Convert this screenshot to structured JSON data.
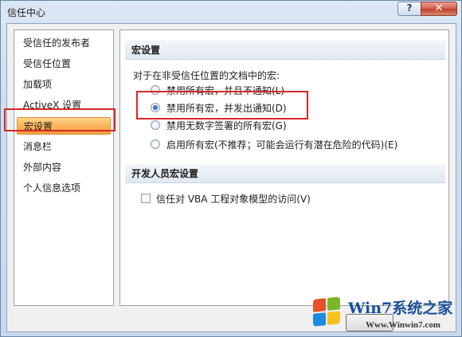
{
  "window": {
    "title": "信任中心",
    "help_label": "?",
    "close_label": "✕"
  },
  "nav": {
    "items": [
      {
        "label": "受信任的发布者",
        "active": false
      },
      {
        "label": "受信任位置",
        "active": false
      },
      {
        "label": "加载项",
        "active": false
      },
      {
        "label": "ActiveX 设置",
        "active": false
      },
      {
        "label": "宏设置",
        "active": true
      },
      {
        "label": "消息栏",
        "active": false
      },
      {
        "label": "外部内容",
        "active": false
      },
      {
        "label": "个人信息选项",
        "active": false
      }
    ]
  },
  "macro_settings": {
    "header": "宏设置",
    "intro": "对于在非受信任位置的文档中的宏:",
    "options": [
      {
        "label": "禁用所有宏，并且不通知(L)",
        "checked": false
      },
      {
        "label": "禁用所有宏，并发出通知(D)",
        "checked": true
      },
      {
        "label": "禁用无数字签署的所有宏(G)",
        "checked": false
      },
      {
        "label": "启用所有宏(不推荐；可能会运行有潜在危险的代码)(E)",
        "checked": false
      }
    ]
  },
  "developer_settings": {
    "header": "开发人员宏设置",
    "checkbox_label": "信任对 VBA 工程对象模型的访问(V)",
    "checkbox_checked": false
  },
  "watermark": {
    "title": "Win7系统之家",
    "url": "Www.Winwin7.com"
  },
  "colors": {
    "highlight_box": "#d9262a",
    "active_nav": "#f5a03c"
  }
}
